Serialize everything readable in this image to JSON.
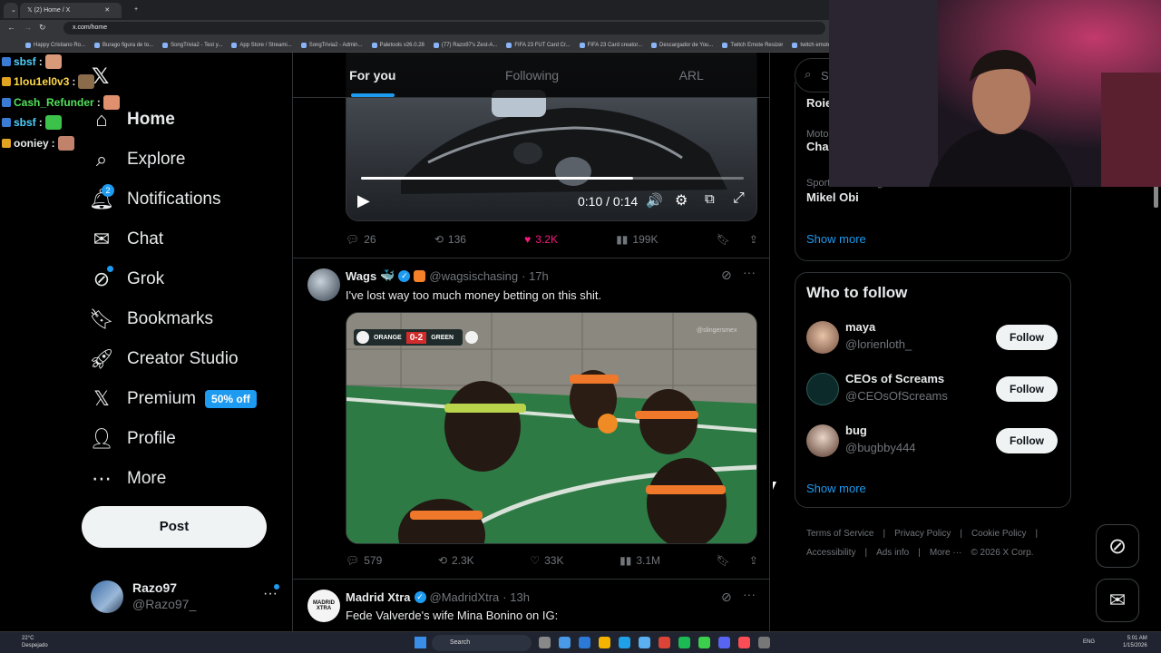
{
  "browser": {
    "tabs": [
      {
        "label": "(2) Home / X"
      }
    ],
    "url": "x.com/home",
    "bookmarks": [
      "Happy Cristiano Ro...",
      "Burago figura de to...",
      "SongTrivia2 - Test y...",
      "App Store / Streami...",
      "SongTrivia2 - Admin...",
      "Paletools v26.0.28",
      "(77) Razo97's Zest-A...",
      "FIFA 23 FUT Card Cr...",
      "FIFA 23 Card creator...",
      "Descargador de You...",
      "Twitch Emote Resizer",
      "twitch emote re"
    ]
  },
  "chat": [
    {
      "user": "sbsf",
      "color": "#4fd1ff"
    },
    {
      "user": "1lou1el0v3",
      "color": "#ffd84a"
    },
    {
      "user": "Cash_Refunder",
      "color": "#52e05a"
    },
    {
      "user": "sbsf",
      "color": "#4fd1ff"
    },
    {
      "user": "ooniey",
      "color": "#e7e9ea"
    }
  ],
  "nav": {
    "items": [
      {
        "label": "Home",
        "icon": "home-icon"
      },
      {
        "label": "Explore",
        "icon": "search-icon"
      },
      {
        "label": "Notifications",
        "icon": "bell-icon",
        "badge": "2"
      },
      {
        "label": "Chat",
        "icon": "mail-icon"
      },
      {
        "label": "Grok",
        "icon": "grok-icon"
      },
      {
        "label": "Bookmarks",
        "icon": "bookmark-icon"
      },
      {
        "label": "Creator Studio",
        "icon": "rocket-icon"
      },
      {
        "label": "Premium",
        "icon": "x-icon",
        "promo": "50% off"
      },
      {
        "label": "Profile",
        "icon": "person-icon"
      },
      {
        "label": "More",
        "icon": "more-circle-icon"
      }
    ],
    "post_label": "Post",
    "account": {
      "name": "Razo97",
      "handle": "@Razo97_"
    }
  },
  "feed": {
    "tabs": [
      "For you",
      "Following",
      "ARL"
    ],
    "video": {
      "time": "0:10 / 0:14",
      "progress": 0.71
    },
    "tweet1_actions": {
      "replies": "26",
      "reposts": "136",
      "likes": "3.2K",
      "views": "199K"
    },
    "tweet2": {
      "name": "Wags",
      "handle": "@wagsischasing",
      "time": "· 17h",
      "text": "I've lost way too much money betting on this shit.",
      "score": {
        "home": "ORANGE",
        "result": "0-2",
        "away": "GREEN"
      },
      "watermark": "@slingersmex",
      "actions": {
        "replies": "579",
        "reposts": "2.3K",
        "likes": "33K",
        "views": "3.1M"
      }
    },
    "tweet3": {
      "name": "Madrid Xtra",
      "handle": "@MadridXtra",
      "time": "· 13h",
      "text": "Fede Valverde's wife Mina Bonino on IG:",
      "avatar_text": "MADRID XTRA"
    }
  },
  "right": {
    "search_placeholder": "Se",
    "trends": [
      {
        "meta": "",
        "title": "Roie"
      },
      {
        "meta": "Moto",
        "title": "Cha"
      },
      {
        "meta": "Sports · Trending",
        "title": "Mikel Obi"
      }
    ],
    "show_more": "Show more",
    "who_to_follow": {
      "title": "Who to follow",
      "users": [
        {
          "name": "maya",
          "handle": "@lorienloth_",
          "button": "Follow"
        },
        {
          "name": "CEOs of Screams",
          "handle": "@CEOsOfScreams",
          "button": "Follow"
        },
        {
          "name": "bug",
          "handle": "@bugbby444",
          "button": "Follow"
        }
      ],
      "show_more": "Show more"
    },
    "footer": [
      "Terms of Service",
      "|",
      "Privacy Policy",
      "|",
      "Cookie Policy",
      "|",
      "Accessibility",
      "|",
      "Ads info",
      "|",
      "More ···",
      "© 2026 X Corp."
    ]
  },
  "taskbar": {
    "weather": {
      "temp": "22°C",
      "desc": "Despejado"
    },
    "search": "Search",
    "lang": "ENG",
    "time": "5:01 AM",
    "date": "1/15/2026"
  }
}
